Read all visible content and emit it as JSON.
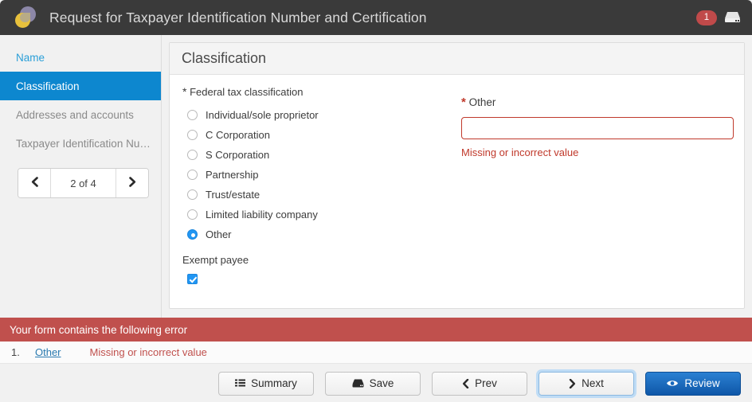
{
  "header": {
    "title": "Request for Taxpayer Identification Number and Certification",
    "logo_icon": "overlapping-circles-logo",
    "badge_count": "1",
    "drive_icon": "drive-icon",
    "badge_color": "#c04a4a",
    "background_color": "#3a3a3a"
  },
  "sidebar": {
    "items": [
      {
        "label": "Name",
        "state": "link"
      },
      {
        "label": "Classification",
        "state": "active"
      },
      {
        "label": "Addresses and accounts",
        "state": "normal"
      },
      {
        "label": "Taxpayer Identification Nu…",
        "state": "normal"
      }
    ],
    "active_color": "#0d87cf",
    "pager": {
      "prev_icon": "chevron-left-icon",
      "next_icon": "chevron-right-icon",
      "label": "2 of 4"
    }
  },
  "panel": {
    "title": "Classification",
    "federal_tax": {
      "required_marker": "*",
      "label": "Federal tax classification",
      "options": [
        {
          "label": "Individual/sole proprietor",
          "selected": false
        },
        {
          "label": "C Corporation",
          "selected": false
        },
        {
          "label": "S Corporation",
          "selected": false
        },
        {
          "label": "Partnership",
          "selected": false
        },
        {
          "label": "Trust/estate",
          "selected": false
        },
        {
          "label": "Limited liability company",
          "selected": false
        },
        {
          "label": "Other",
          "selected": true
        }
      ]
    },
    "exempt_payee": {
      "label": "Exempt payee",
      "checked": true
    },
    "other_field": {
      "required_marker": "*",
      "label": "Other",
      "value": "",
      "placeholder": "",
      "error": "Missing or incorrect value",
      "error_color": "#c0392b"
    }
  },
  "error_banner": {
    "heading": "Your form contains the following error",
    "heading_color": "#c0504d",
    "rows": [
      {
        "number": "1.",
        "link": "Other",
        "message": "Missing or incorrect value"
      }
    ]
  },
  "footer": {
    "buttons": [
      {
        "label": "Summary",
        "icon": "list-icon",
        "style": "default"
      },
      {
        "label": "Save",
        "icon": "drive-icon",
        "style": "default"
      },
      {
        "label": "Prev",
        "icon": "chevron-left-icon",
        "style": "default"
      },
      {
        "label": "Next",
        "icon": "chevron-right-icon",
        "style": "focused"
      },
      {
        "label": "Review",
        "icon": "eye-icon",
        "style": "primary"
      }
    ]
  }
}
